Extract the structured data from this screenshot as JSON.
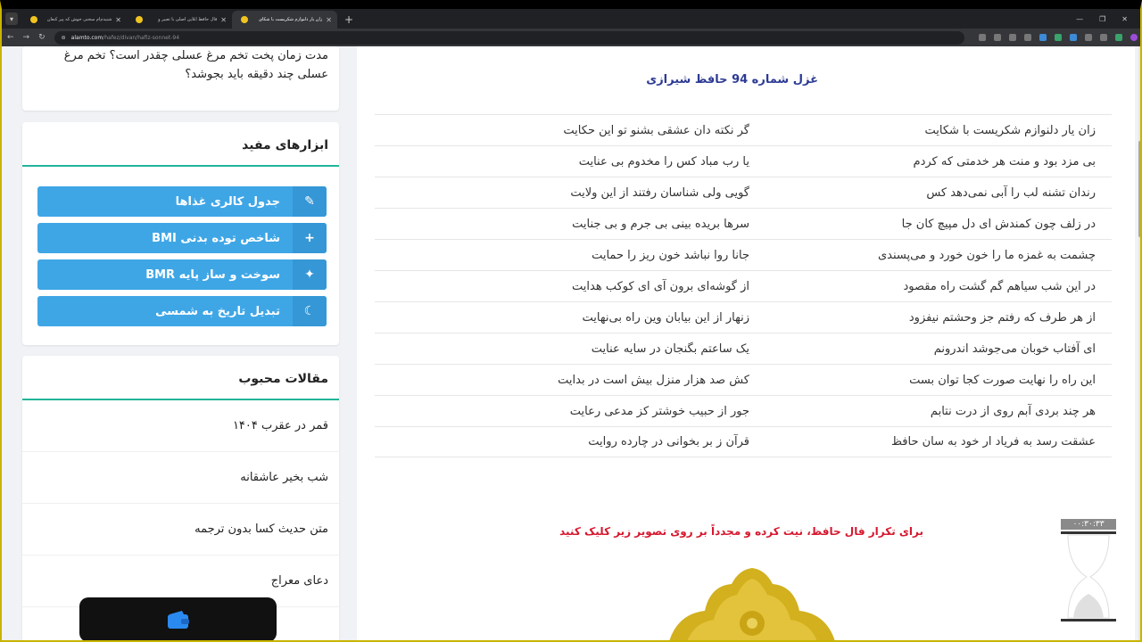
{
  "browser": {
    "tabs": [
      {
        "title": "شنیدم‌ام سخنی خوش که پیر کنعان"
      },
      {
        "title": "فال حافظ آنلاین اصلی با تعبیر و"
      },
      {
        "title": "زان یار دلنوازم شکریست با شکای"
      }
    ],
    "url_host": "alamto.com",
    "url_path": "/hafez/divan/hafiz-sonnet-94"
  },
  "sidebar": {
    "top_card_text": "مدت زمان پخت تخم مرغ عسلی چقدر است؟ تخم مرغ عسلی چند دقیقه باید بجوشد؟",
    "tools_title": "ابزارهای مفید",
    "tools": [
      {
        "label": "جدول کالری غذاها",
        "icon": "pencil-icon",
        "glyph": "✎"
      },
      {
        "label": "شاخص توده بدنی BMI",
        "icon": "plus-icon",
        "glyph": "+"
      },
      {
        "label": "سوخت و ساز پایه BMR",
        "icon": "sparkle-icon",
        "glyph": "✦"
      },
      {
        "label": "تبدیل تاریخ به شمسی",
        "icon": "moon-icon",
        "glyph": "☾"
      }
    ],
    "popular_title": "مقالات محبوب",
    "popular": [
      "قمر در عقرب ۱۴۰۴",
      "شب بخیر عاشقانه",
      "متن حدیث کسا بدون ترجمه",
      "دعای معراج"
    ]
  },
  "main": {
    "poem_title": "غزل شماره 94 حافظ شیرازی",
    "verses": [
      [
        "زان یار دلنوازم شکریست با شکایت",
        "گر نکته دان عشقی بشنو تو این حکایت"
      ],
      [
        "بی مزد بود و منت هر خدمتی که کردم",
        "یا رب مباد کس را مخدوم بی عنایت"
      ],
      [
        "رندان تشنه لب را آبی نمی‌دهد کس",
        "گویی ولی شناسان رفتند از این ولایت"
      ],
      [
        "در زلف چون کمندش ای دل مپیچ کان جا",
        "سرها بریده بینی بی جرم و بی جنایت"
      ],
      [
        "چشمت به غمزه ما را خون خورد و می‌پسندی",
        "جانا روا نباشد خون ریز را حمایت"
      ],
      [
        "در این شب سیاهم گم گشت راه مقصود",
        "از گوشه‌ای برون آی ای کوکب هدایت"
      ],
      [
        "از هر طرف که رفتم جز وحشتم نیفزود",
        "زنهار از این بیابان وین راه بی‌نهایت"
      ],
      [
        "ای آفتاب خوبان می‌جوشد اندرونم",
        "یک ساعتم بگنجان در سایه عنایت"
      ],
      [
        "این راه را نهایت صورت کجا توان بست",
        "کش صد هزار منزل بیش است در بدایت"
      ],
      [
        "هر چند بردی آبم روی از درت نتابم",
        "جور از حبیب خوشتر کز مدعی رعایت"
      ],
      [
        "عشقت رسد به فریاد ار خود به سان حافظ",
        "قرآن ز بر بخوانی در چارده روایت"
      ]
    ],
    "repeat_note": "برای تکرار فال حافظ، نیت کرده و مجدداً بر روی تصویر زیر کلیک کنید"
  },
  "timer": {
    "label": "۰۰:۳۰:۳۳"
  },
  "colors": {
    "accent_teal": "#22b59a",
    "button_blue": "#3fa6e6",
    "title_navy": "#2c3a94",
    "note_red": "#d6182f"
  }
}
